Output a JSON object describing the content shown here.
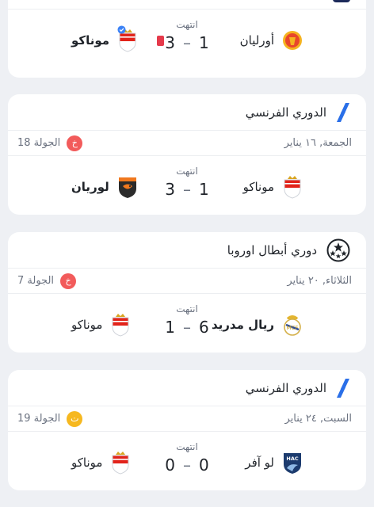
{
  "colors": {
    "background": "#eef0f4",
    "card": "#ffffff",
    "badge_loss": "#f25b5b",
    "badge_draw": "#f6b81f",
    "red_card": "#e53a4b",
    "ligue1_icon": "#2a6fe8",
    "verified": "#3b82f6"
  },
  "matches": [
    {
      "status": "انتهت",
      "score_home": "1",
      "score_away": "3",
      "home": {
        "name": "أورليان",
        "crest_icon": "orleans-crest-icon"
      },
      "away": {
        "name": "موناكو",
        "crest_icon": "monaco-crest-icon"
      }
    },
    {
      "league": "الدوري الفرنسي",
      "league_icon": "ligue1-logo-icon",
      "date": "الجمعة, ١٦ يناير",
      "round": "الجولة 18",
      "result_badge": "خ",
      "status": "انتهت",
      "score_home": "1",
      "score_away": "3",
      "home": {
        "name": "موناكو",
        "crest_icon": "monaco-crest-icon"
      },
      "away": {
        "name": "لوريان",
        "crest_icon": "lorient-crest-icon"
      }
    },
    {
      "league": "دوري أبطال اوروبا",
      "league_icon": "champions-league-logo-icon",
      "date": "الثلاثاء, ٢٠ يناير",
      "round": "الجولة 7",
      "result_badge": "خ",
      "status": "انتهت",
      "score_home": "6",
      "score_away": "1",
      "home": {
        "name": "ريال مدريد",
        "crest_icon": "real-madrid-crest-icon"
      },
      "away": {
        "name": "موناكو",
        "crest_icon": "monaco-crest-icon"
      }
    },
    {
      "league": "الدوري الفرنسي",
      "league_icon": "ligue1-logo-icon",
      "date": "السبت, ٢٤ يناير",
      "round": "الجولة 19",
      "result_badge": "ت",
      "status": "انتهت",
      "score_home": "0",
      "score_away": "0",
      "home": {
        "name": "لو آفر",
        "crest_icon": "le-havre-crest-icon"
      },
      "away": {
        "name": "موناكو",
        "crest_icon": "monaco-crest-icon"
      }
    }
  ]
}
